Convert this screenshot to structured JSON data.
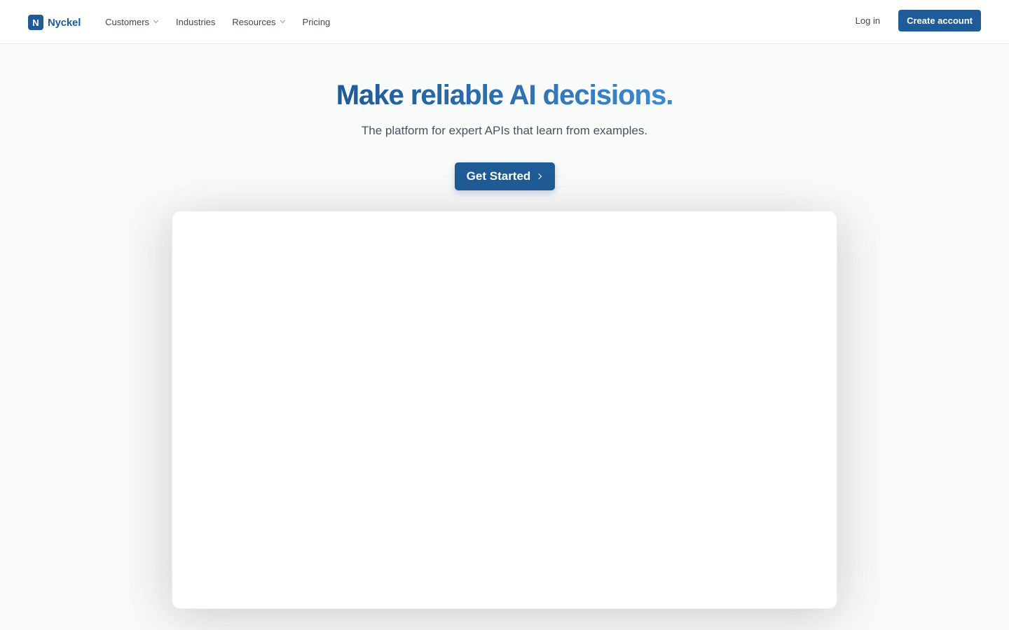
{
  "nav": {
    "brand_mark": "N",
    "brand_name": "Nyckel",
    "links": [
      {
        "label": "Customers",
        "has_dropdown": true
      },
      {
        "label": "Industries",
        "has_dropdown": false
      },
      {
        "label": "Resources",
        "has_dropdown": true
      },
      {
        "label": "Pricing",
        "has_dropdown": false
      }
    ],
    "login_label": "Log in",
    "create_account_label": "Create account"
  },
  "hero": {
    "title": "Make reliable AI decisions.",
    "subtitle": "The platform for expert APIs that learn from examples.",
    "cta_label": "Get Started"
  },
  "colors": {
    "brand": "#1f5b96",
    "title_gradient_end": "#3d8bcf",
    "background": "#f9fafa"
  }
}
